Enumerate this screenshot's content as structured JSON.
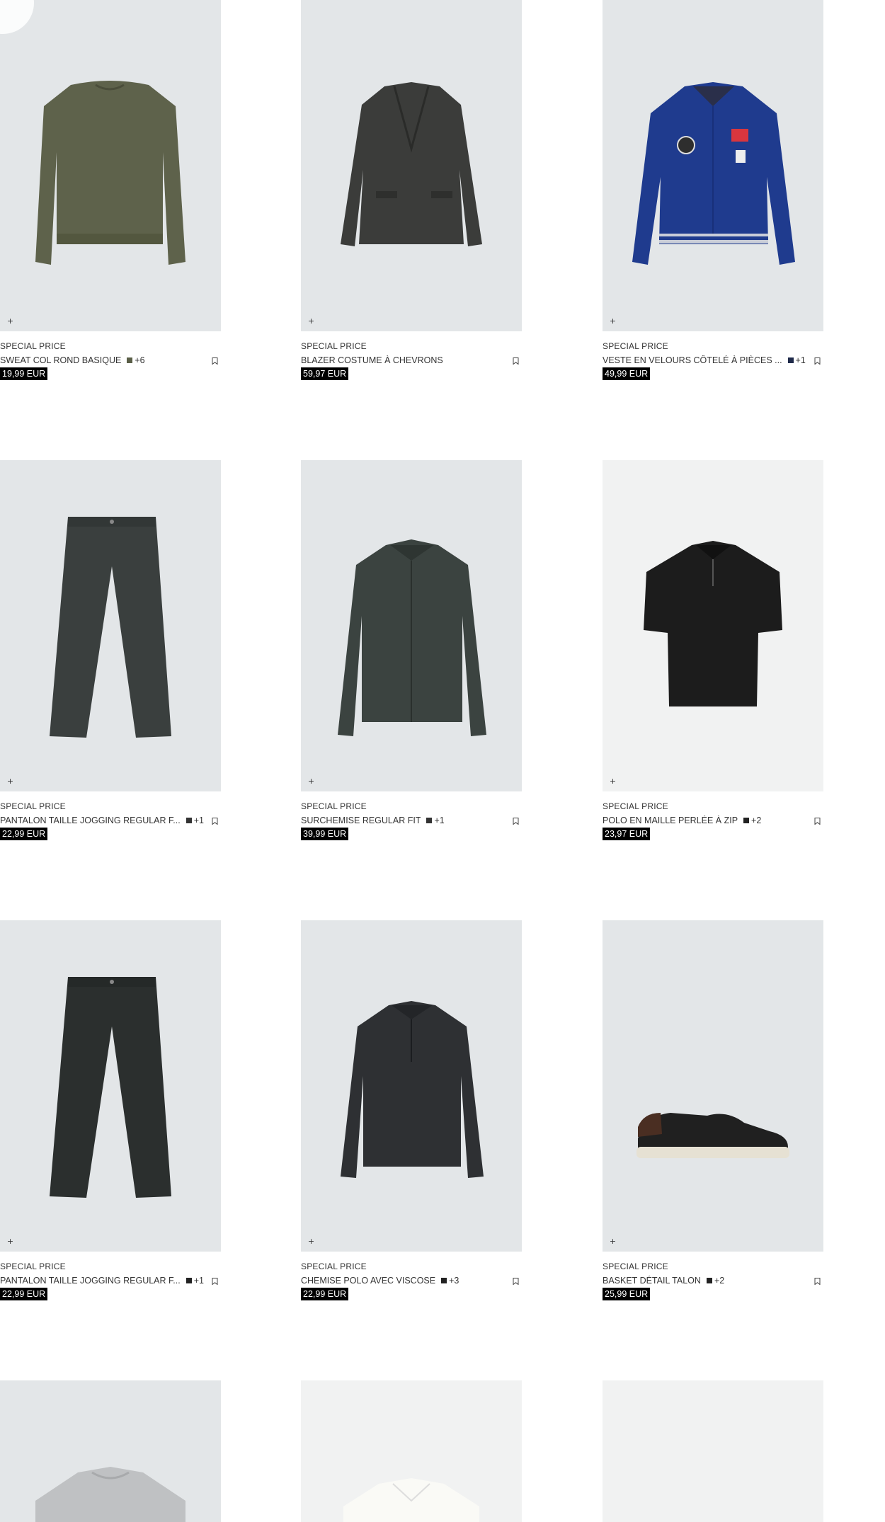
{
  "products": [
    {
      "tag": "SPECIAL PRICE",
      "name": "SWEAT COL ROND BASIQUE",
      "swatch": "#5a5e47",
      "more": "+6",
      "price": "19,99 EUR",
      "icon": "sweater-image"
    },
    {
      "tag": "SPECIAL PRICE",
      "name": "BLAZER COSTUME À CHEVRONS",
      "swatch": "",
      "more": "",
      "price": "59,97 EUR",
      "icon": "blazer-image"
    },
    {
      "tag": "SPECIAL PRICE",
      "name": "VESTE EN VELOURS CÔTELÉ À PIÈCES ...",
      "swatch": "#1f2a4a",
      "more": "+1",
      "price": "49,99 EUR",
      "icon": "jacket-image"
    },
    {
      "tag": "SPECIAL PRICE",
      "name": "PANTALON TAILLE JOGGING REGULAR F...",
      "swatch": "#333333",
      "more": "+1",
      "price": "22,99 EUR",
      "icon": "trousers-image"
    },
    {
      "tag": "SPECIAL PRICE",
      "name": "SURCHEMISE REGULAR FIT",
      "swatch": "#333333",
      "more": "+1",
      "price": "39,99 EUR",
      "icon": "overshirt-image"
    },
    {
      "tag": "SPECIAL PRICE",
      "name": "POLO EN MAILLE PERLÉE À ZIP",
      "swatch": "#222222",
      "more": "+2",
      "price": "23,97 EUR",
      "icon": "polo-image"
    },
    {
      "tag": "SPECIAL PRICE",
      "name": "PANTALON TAILLE JOGGING REGULAR F...",
      "swatch": "#222222",
      "more": "+1",
      "price": "22,99 EUR",
      "icon": "trousers-image"
    },
    {
      "tag": "SPECIAL PRICE",
      "name": "CHEMISE POLO AVEC VISCOSE",
      "swatch": "#222222",
      "more": "+3",
      "price": "22,99 EUR",
      "icon": "shirt-image"
    },
    {
      "tag": "SPECIAL PRICE",
      "name": "BASKET DÉTAIL TALON",
      "swatch": "#222222",
      "more": "+2",
      "price": "25,99 EUR",
      "icon": "sneaker-image"
    }
  ],
  "quick_add_symbol": "+",
  "colors": {
    "image_bg": "#e3e6e8",
    "image_bg_light": "#f1f2f2",
    "price_bg": "#000000",
    "price_text": "#ffffff"
  }
}
